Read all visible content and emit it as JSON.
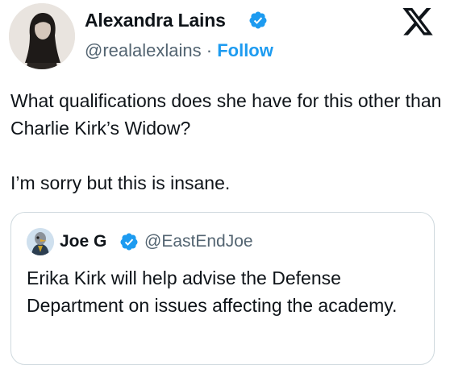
{
  "author": {
    "display_name": "Alexandra Lains",
    "handle": "@realalexlains",
    "separator": "·",
    "follow_label": "Follow"
  },
  "tweet": {
    "lines": [
      "What qualifications does she have for this other than Charlie Kirk’s Widow?",
      "I’m sorry but this is insane."
    ]
  },
  "quoted_tweet": {
    "display_name": "Joe G",
    "handle": "@EastEndJoe",
    "text": "Erika Kirk will help advise the Defense Department on issues affecting the academy."
  },
  "colors": {
    "accent": "#1d9bf0",
    "text_primary": "#0f1419",
    "text_secondary": "#536471",
    "border": "#cfd9de"
  },
  "icons": {
    "verified": "verified-badge-icon",
    "brand": "x-logo-icon"
  }
}
